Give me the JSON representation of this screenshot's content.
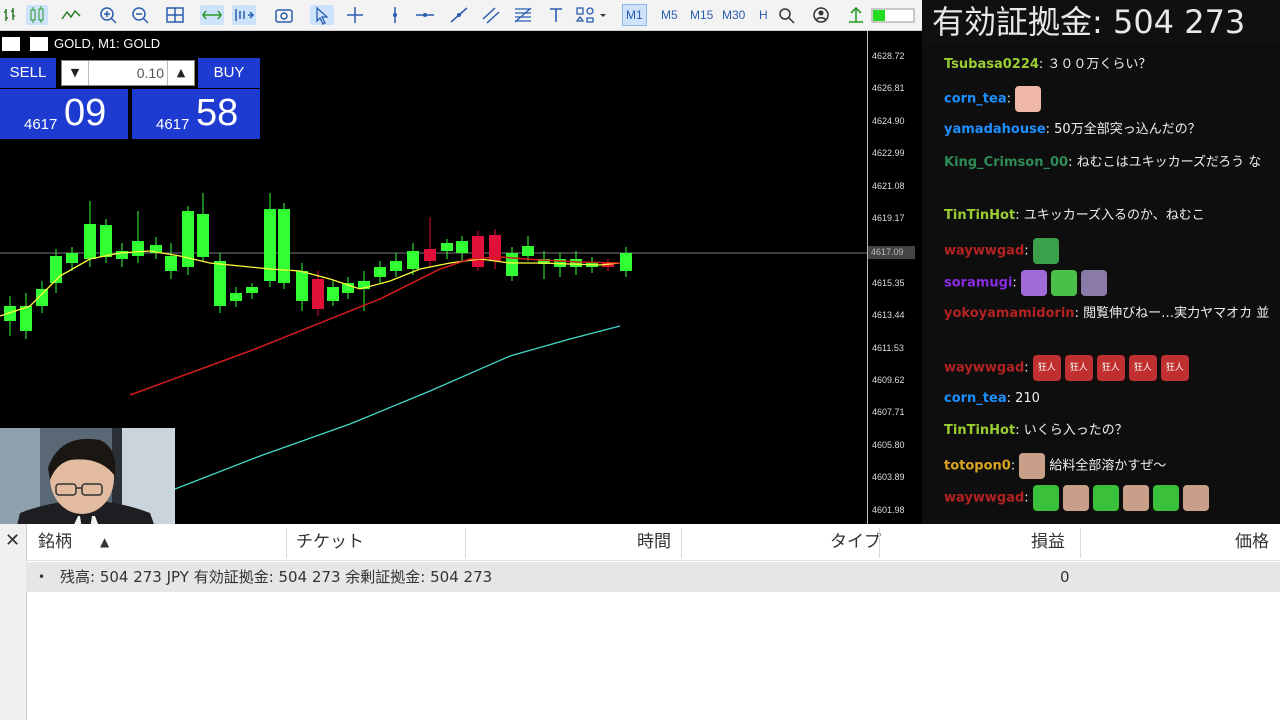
{
  "toolbar": {
    "timeframes": [
      "M1",
      "M5",
      "M15",
      "M30",
      "H"
    ],
    "active_timeframe": "M1"
  },
  "overlay": {
    "equity_label": "有効証拠金: 504 273"
  },
  "chart": {
    "title": "GOLD, M1:  GOLD",
    "sell_label": "SELL",
    "buy_label": "BUY",
    "lot_value": "0.10",
    "sell_price_small": "4617",
    "sell_price_big": "09",
    "buy_price_small": "4617",
    "buy_price_big": "58",
    "price_axis": [
      "4628.72",
      "4626.81",
      "4624.90",
      "4622.99",
      "4621.08",
      "4619.17",
      "4617.09",
      "4615.35",
      "4613.44",
      "4611.53",
      "4609.62",
      "4607.71",
      "4605.80",
      "4603.89",
      "4601.98"
    ],
    "current_price": "4617.09",
    "colors": {
      "bull": "#32ff32",
      "bear": "#e0103a",
      "ma_fast": "#ffff3c",
      "ma_mid": "#d21c1c",
      "ma_slow": "#40d8c8"
    }
  },
  "chat": {
    "messages": [
      {
        "user": "Tsubasa0224",
        "color": "#9acd32",
        "text": "３００万くらい？"
      },
      {
        "user": "corn_tea",
        "color": "#1e90ff",
        "text": "",
        "emotes": [
          "hand"
        ]
      },
      {
        "user": "yamadahouse",
        "color": "#1e90ff",
        "text": "50万全部突っ込んだの？"
      },
      {
        "user": "King_Crimson_00",
        "color": "#2e8b57",
        "text": "ねむこはユキッカーズだろう な"
      },
      {
        "user": "TinTinHot",
        "color": "#9acd32",
        "text": "ユキッカーズ入るのか、ねむこ"
      },
      {
        "user": "waywwgad",
        "color": "#b22222",
        "text": "",
        "emotes": [
          "pepe"
        ]
      },
      {
        "user": "soramugi",
        "color": "#8a2be2",
        "text": "",
        "emotes": [
          "purple",
          "green",
          "cat"
        ]
      },
      {
        "user": "yokoyamamidorin",
        "color": "#b22222",
        "text": "閲覧伸びねー…実力ヤマオカ 並"
      },
      {
        "user": "waywwgad",
        "color": "#b22222",
        "text": "",
        "emotes": [
          "kyo",
          "kyo",
          "kyo",
          "kyo",
          "kyo"
        ],
        "emote_text": "狂人"
      },
      {
        "user": "corn_tea",
        "color": "#1e90ff",
        "text": "210"
      },
      {
        "user": "TinTinHot",
        "color": "#9acd32",
        "text": "いくら入ったの？"
      },
      {
        "user": "totopon0",
        "color": "#daa520",
        "text": "給料全部溶かすぜ〜",
        "emotes": [
          "face"
        ]
      },
      {
        "user": "waywwgad",
        "color": "#b22222",
        "text": "",
        "emotes": [
          "pepeg",
          "face",
          "pepeg",
          "face",
          "pepeg",
          "face"
        ]
      }
    ]
  },
  "terminal": {
    "headers": [
      "銘柄",
      "チケット",
      "時間",
      "タイプ",
      "損益",
      "価格"
    ],
    "summary": "残高: 504 273 JPY  有効証拠金: 504 273  余剰証拠金: 504 273",
    "profit": "0"
  }
}
